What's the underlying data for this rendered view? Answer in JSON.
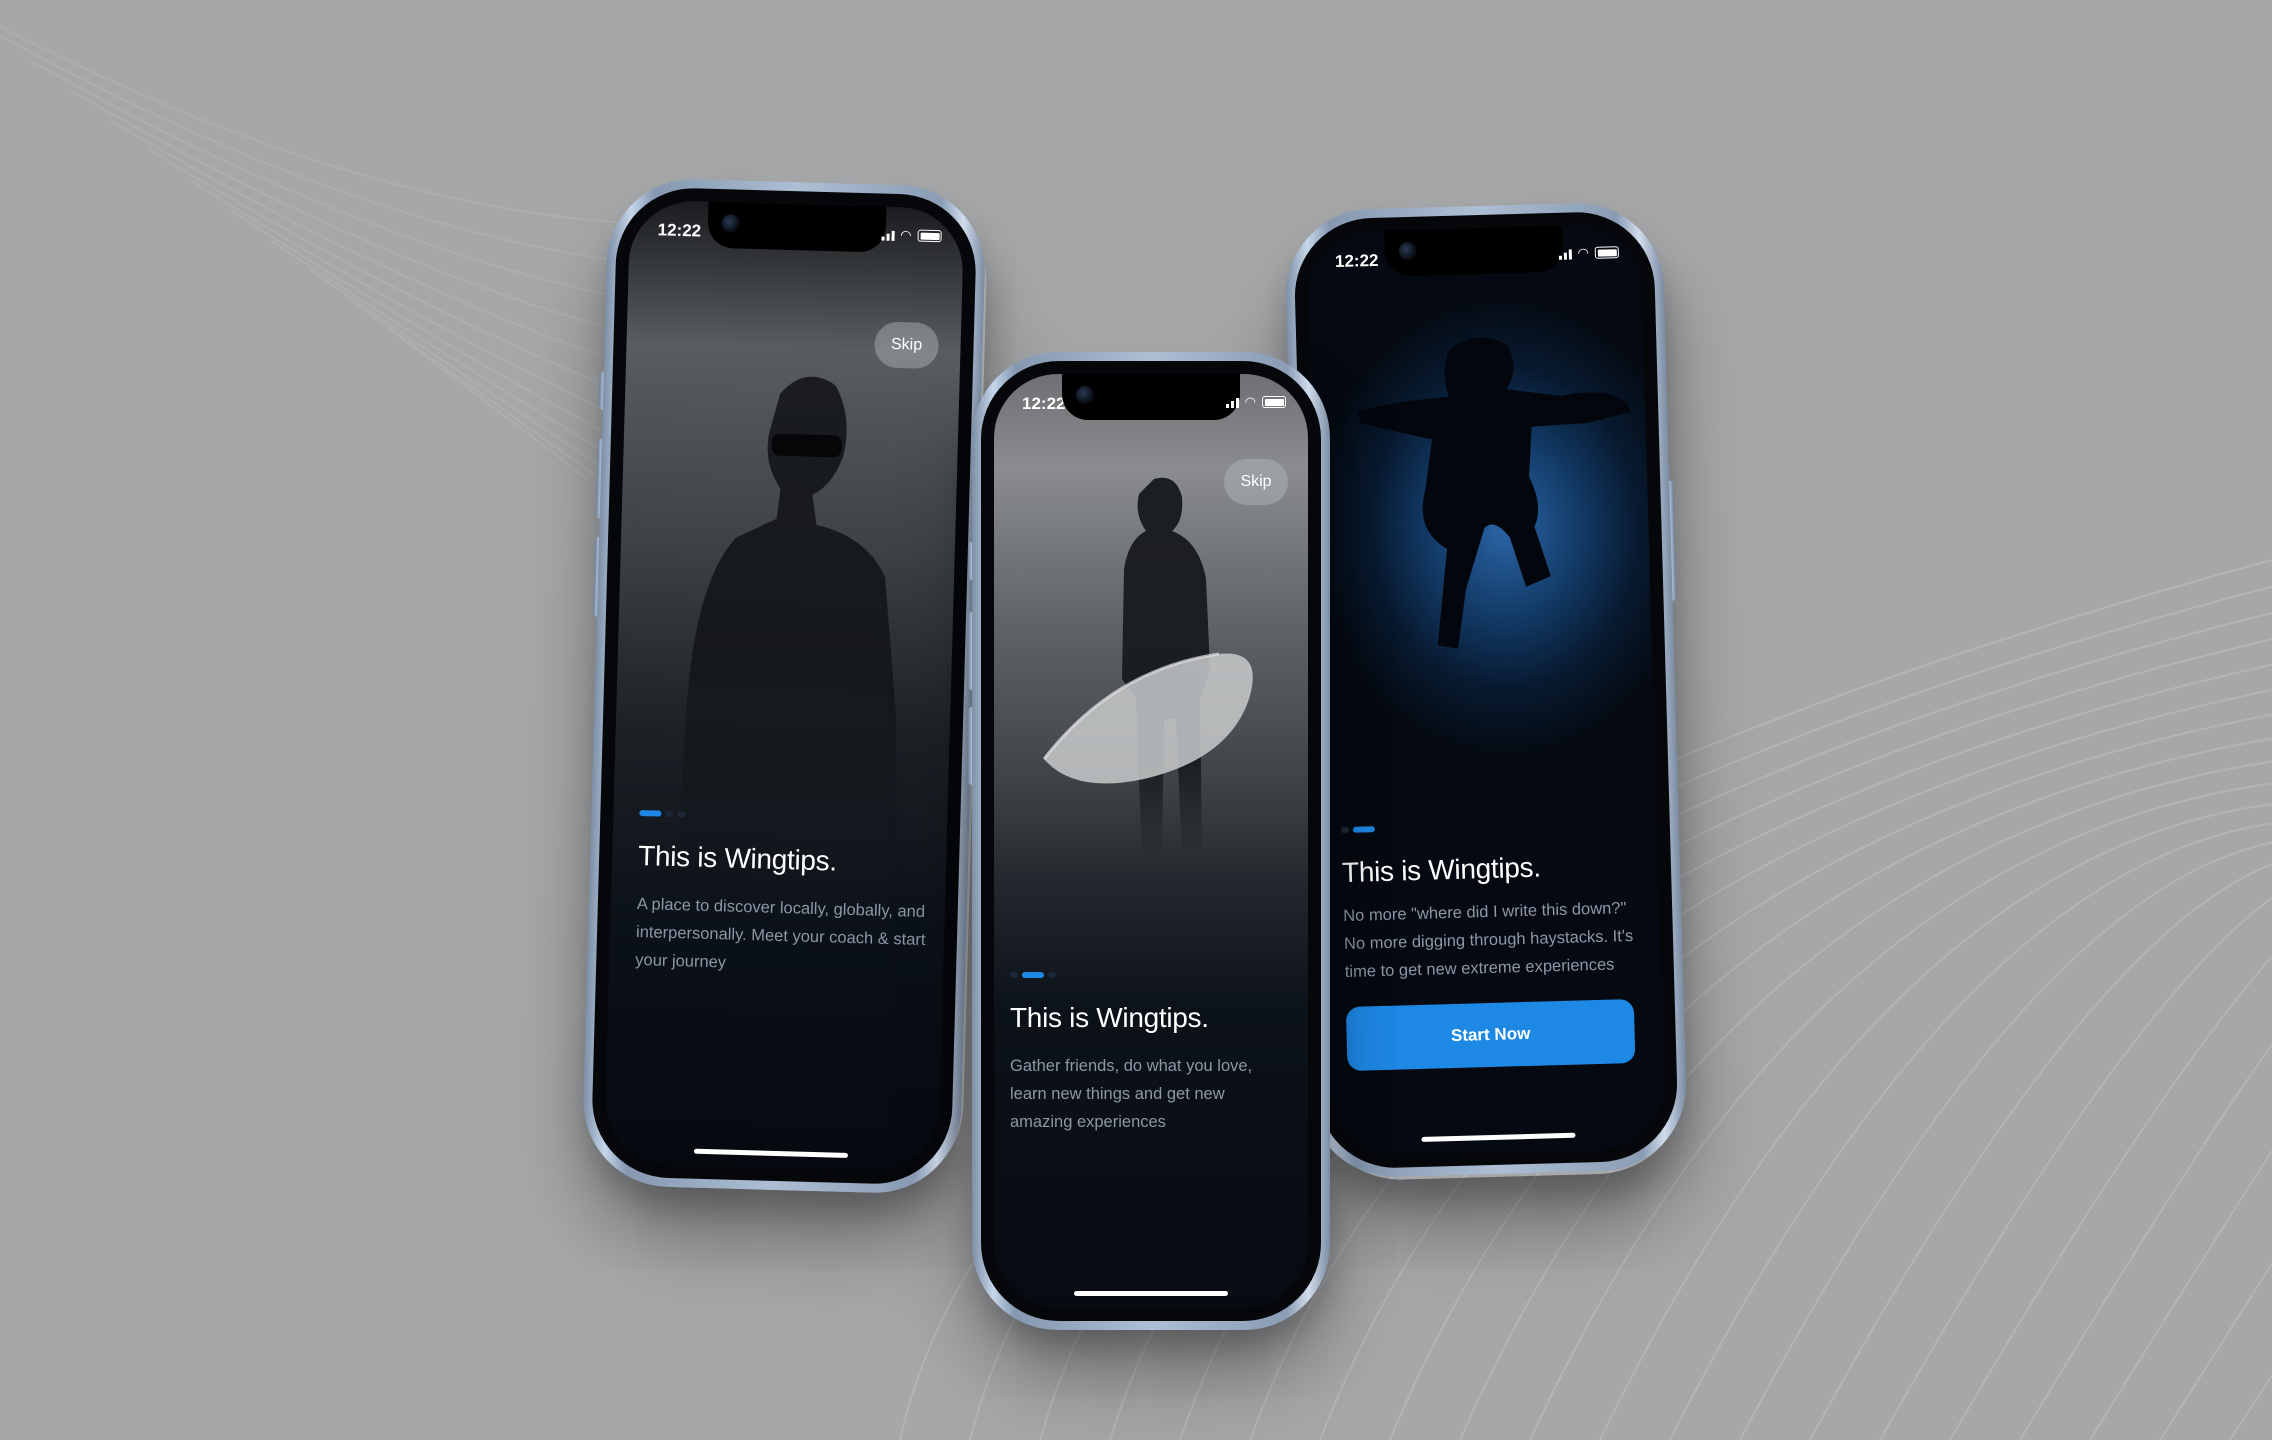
{
  "colors": {
    "background": "#a6a7a9",
    "accent": "#1e88e5",
    "screen_dark": "#060a10",
    "frame": "#a9bcd3"
  },
  "phones": [
    {
      "status_time": "12:22",
      "skip_label": "Skip",
      "title": "This is Wingtips.",
      "description": "A place to discover locally, globally, and interpersonally. Meet your coach & start your journey",
      "pager": {
        "current": 1,
        "total": 3
      },
      "photo": "man-with-sunglasses-portrait"
    },
    {
      "status_time": "12:22",
      "skip_label": "Skip",
      "title": "This is Wingtips.",
      "description": "Gather friends, do what you love, learn new things and get new amazing experiences",
      "pager": {
        "current": 2,
        "total": 3
      },
      "photo": "surfer-holding-board"
    },
    {
      "status_time": "12:22",
      "title": "This is Wingtips.",
      "description": "No more \"where did I write this down?\" No more digging through haystacks. It's time to get new extreme experiences",
      "pager": {
        "current": 3,
        "total": 3
      },
      "cta_label": "Start Now",
      "photo": "jumping-silhouette"
    }
  ]
}
